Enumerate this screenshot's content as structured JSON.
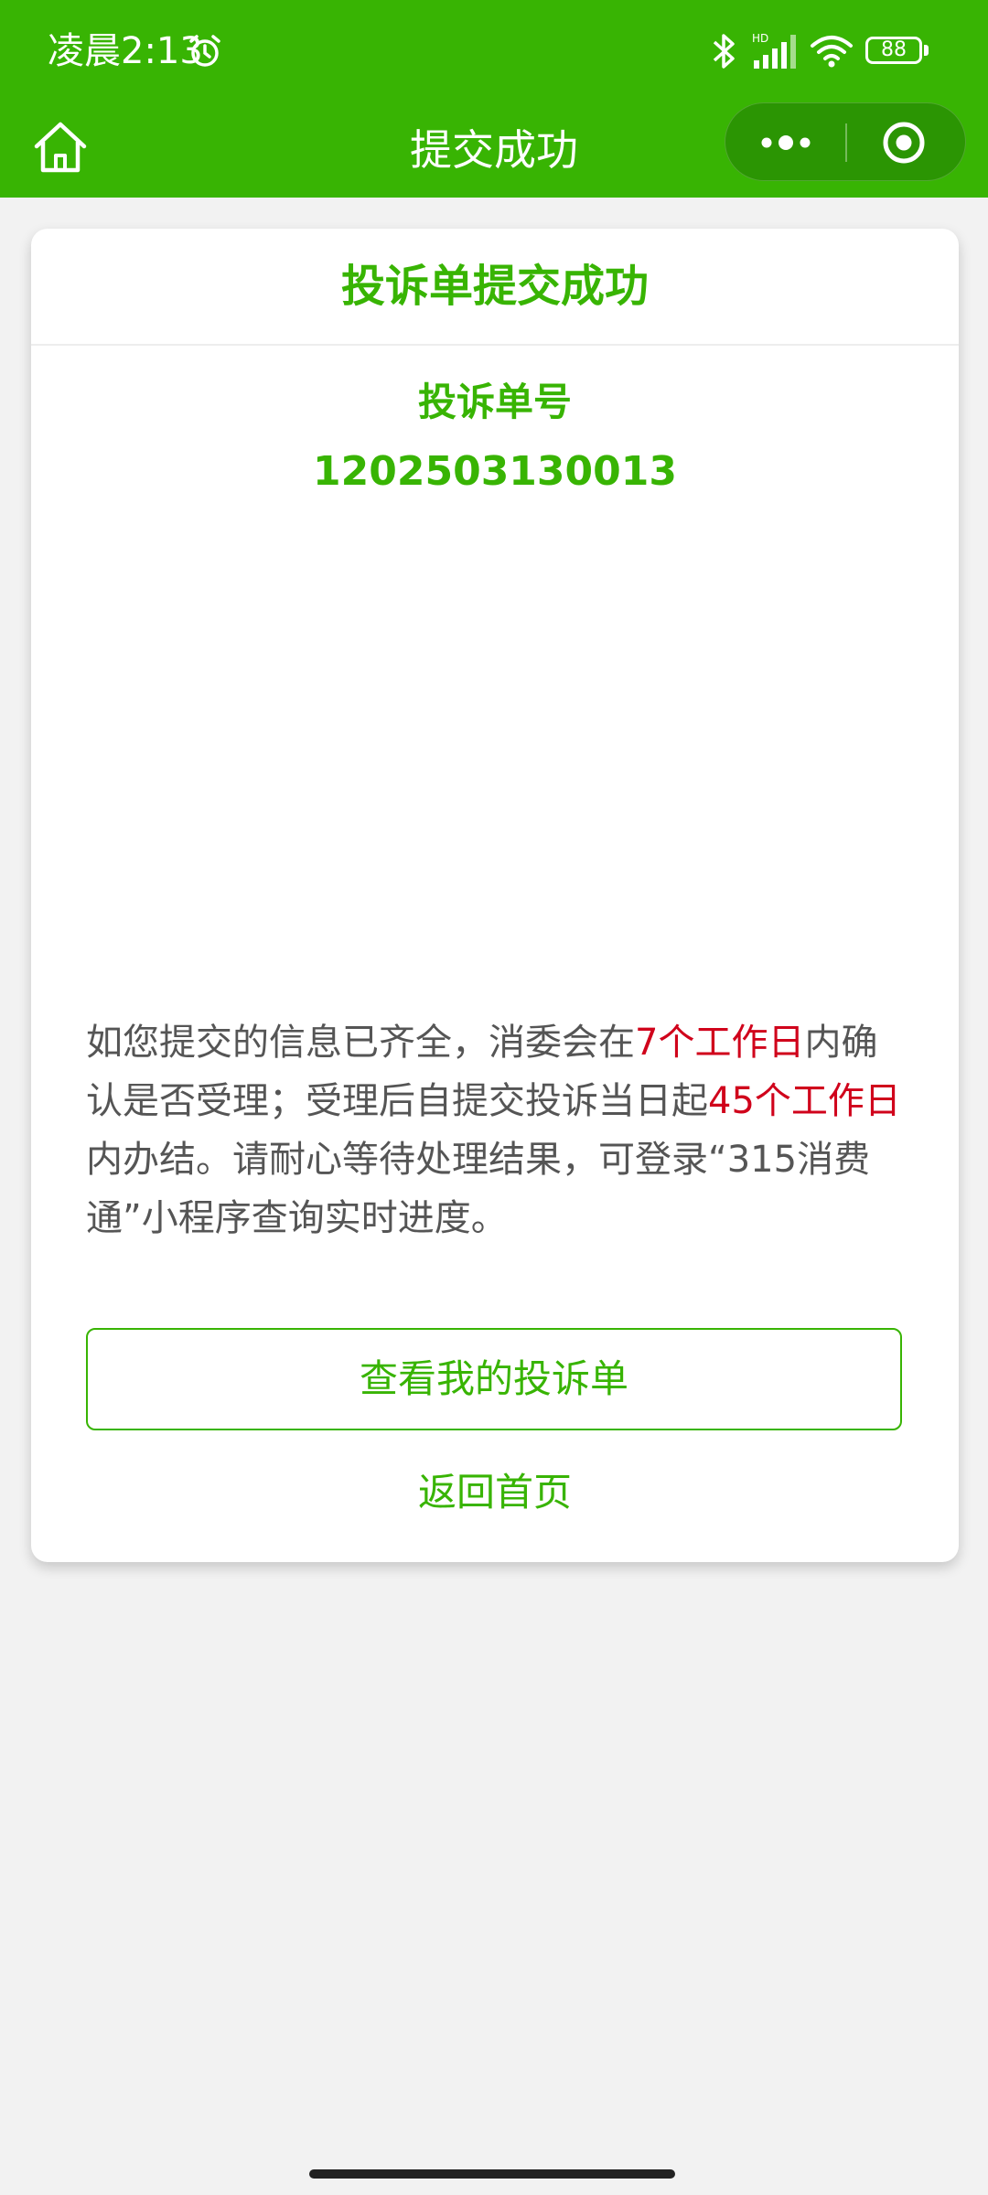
{
  "status_bar": {
    "time": "凌晨2:13",
    "battery": "88",
    "signal_label": "HD"
  },
  "nav": {
    "title": "提交成功"
  },
  "card": {
    "title": "投诉单提交成功",
    "complaint_label": "投诉单号",
    "complaint_number": "1202503130013"
  },
  "notice": {
    "part1": "如您提交的信息已齐全，消委会在",
    "highlight1": "7个工作日",
    "part2": "内确认是否受理；受理后自提交投诉当日起",
    "highlight2": "45个工作日",
    "part3": "内办结。请耐心等待处理结果，可登录“315消费通”小程序查询实时进度。"
  },
  "buttons": {
    "view_complaints": "查看我的投诉单",
    "back_home": "返回首页"
  },
  "colors": {
    "brand_green": "#38b403",
    "highlight_red": "#d0021b"
  },
  "icons": {
    "home": "home-icon",
    "more": "more-dots-icon",
    "close": "target-close-icon",
    "alarm": "alarm-icon",
    "bluetooth": "bluetooth-icon",
    "signal": "signal-icon",
    "wifi": "wifi-icon"
  }
}
